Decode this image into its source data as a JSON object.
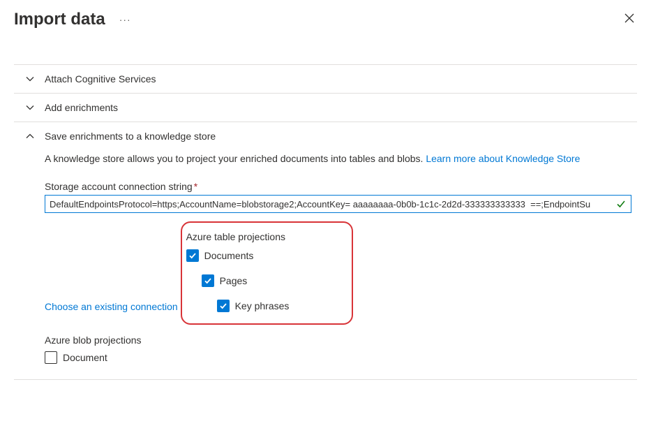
{
  "header": {
    "title": "Import data",
    "ellipsis": "···"
  },
  "accordion": {
    "attach": "Attach Cognitive Services",
    "enrich": "Add enrichments",
    "knowledge": "Save enrichments to a knowledge store"
  },
  "knowledgeStore": {
    "description_prefix": "A knowledge store allows you to project your enriched documents into tables and blobs. ",
    "learn_more": "Learn more about Knowledge Store",
    "conn_label": "Storage account connection string",
    "conn_value": "DefaultEndpointsProtocol=https;AccountName=blobstorage2;AccountKey= aaaaaaaa-0b0b-1c1c-2d2d-333333333333  ==;EndpointSu",
    "choose_existing": "Choose an existing connection",
    "table_group": "Azure table projections",
    "blob_group": "Azure blob projections",
    "items": {
      "documents": "Documents",
      "pages": "Pages",
      "key_phrases": "Key phrases",
      "document": "Document"
    }
  }
}
